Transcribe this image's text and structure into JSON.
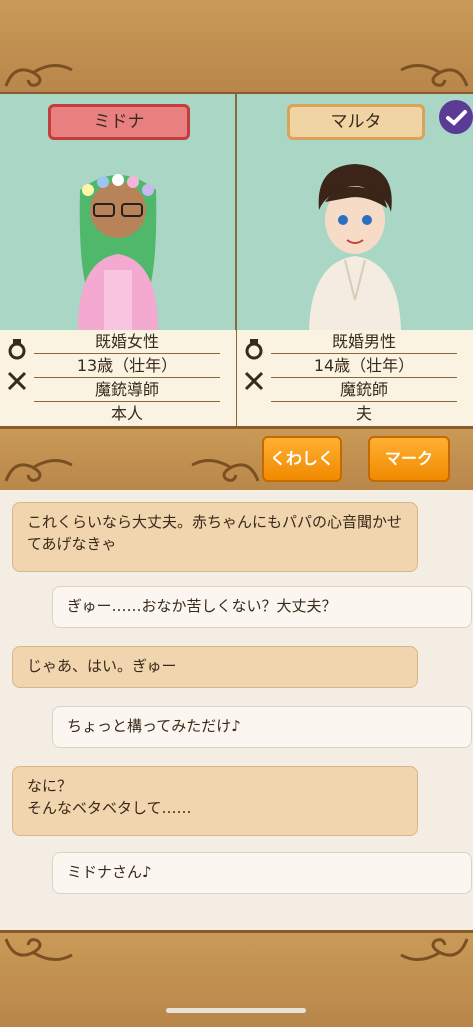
{
  "characters": [
    {
      "name": "ミドナ",
      "status": "既婚女性",
      "age": "13歳（壮年）",
      "job": "魔銃導師",
      "relation": "本人"
    },
    {
      "name": "マルタ",
      "status": "既婚男性",
      "age": "14歳（壮年）",
      "job": "魔銃師",
      "relation": "夫"
    }
  ],
  "buttons": {
    "details": "くわしく",
    "mark": "マーク"
  },
  "messages": [
    {
      "side": "left",
      "text": "これくらいなら大丈夫。赤ちゃんにもパパの心音聞かせてあげなきゃ"
    },
    {
      "side": "right",
      "text": "ぎゅー……おなか苦しくない？大丈夫？"
    },
    {
      "side": "left",
      "text": "じゃあ、はい。ぎゅー"
    },
    {
      "side": "right",
      "text": "ちょっと構ってみただけ♪"
    },
    {
      "side": "left",
      "text": "なに？\nそんなベタベタして……"
    },
    {
      "side": "right",
      "text": "ミドナさん♪"
    }
  ],
  "icons": {
    "ring": "ring-icon",
    "swords": "crossed-swords-icon",
    "check": "check-badge-icon"
  },
  "colors": {
    "background": "#a9d6c5",
    "frame": "#c0914f",
    "button": "#f59a10",
    "name_female": "#e88080",
    "name_male": "#f1d4a3"
  }
}
